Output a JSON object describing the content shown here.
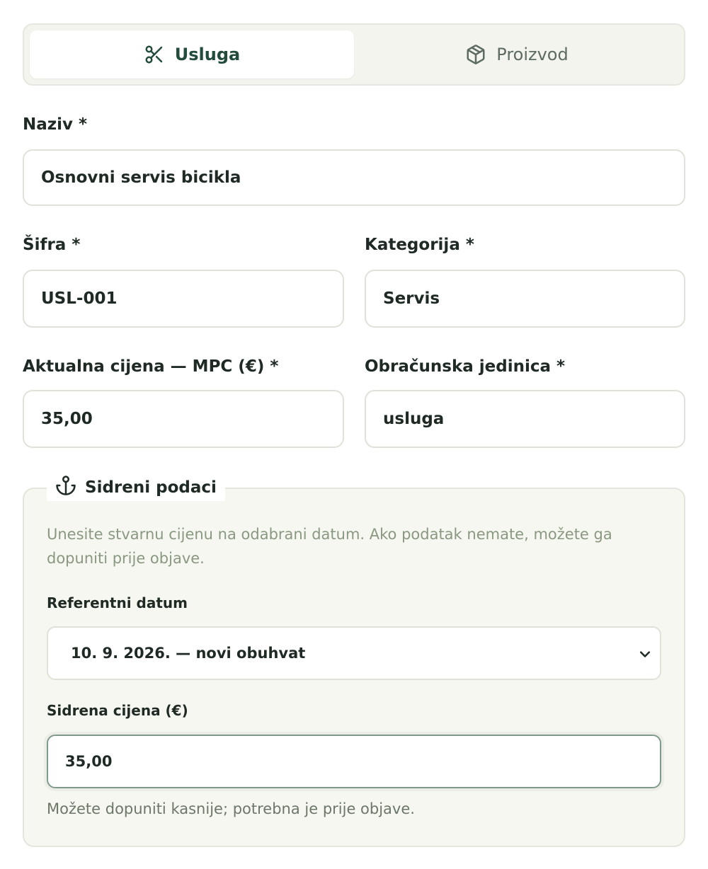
{
  "tabs": [
    {
      "label": "Usluga",
      "icon": "scissors-icon",
      "active": true
    },
    {
      "label": "Proizvod",
      "icon": "package-icon",
      "active": false
    }
  ],
  "form": {
    "naziv": {
      "label": "Naziv *",
      "value": "Osnovni servis bicikla"
    },
    "sifra": {
      "label": "Šifra *",
      "value": "USL-001"
    },
    "kategorija": {
      "label": "Kategorija *",
      "value": "Servis"
    },
    "cijena": {
      "label": "Aktualna cijena — MPC (€) *",
      "value": "35,00"
    },
    "jedinica": {
      "label": "Obračunska jedinica *",
      "value": "usluga"
    }
  },
  "anchor": {
    "legend": "Sidreni podaci",
    "icon": "anchor-icon",
    "hint": "Unesite stvarnu cijenu na odabrani datum. Ako podatak nemate, možete ga dopuniti prije objave.",
    "date_label": "Referentni datum",
    "date_value": "10. 9. 2026. — novi obuhvat",
    "price_label": "Sidrena cijena (€)",
    "price_value": "35,00",
    "price_hint": "Možete dopuniti kasnije; potrebna je prije objave."
  },
  "colors": {
    "accent": "#234c3c",
    "hint": "#8a9882",
    "panel": "#f6f7f1"
  }
}
